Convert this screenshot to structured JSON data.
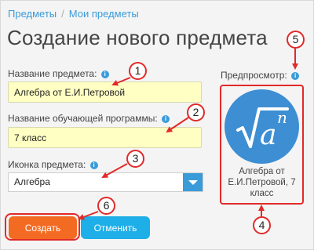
{
  "breadcrumb": {
    "items": [
      "Предметы",
      "Мои предметы"
    ],
    "separator": "/"
  },
  "page_title": "Создание нового предмета",
  "form": {
    "name_label": "Название предмета:",
    "name_value": "Алгебра от Е.И.Петровой",
    "program_label": "Название обучающей программы:",
    "program_value": "7 класс",
    "icon_label": "Иконка предмета:",
    "icon_value": "Алгебра"
  },
  "preview": {
    "label": "Предпросмотр:",
    "caption": "Алгебра от Е.И.Петровой, 7 класс",
    "icon": "square-root-a-n-icon"
  },
  "buttons": {
    "create": "Создать",
    "cancel": "Отменить"
  },
  "info_glyph": "i",
  "callouts": [
    "1",
    "2",
    "3",
    "4",
    "5",
    "6"
  ],
  "colors": {
    "accent": "#3a9bd9",
    "field_bg": "#ffffc4",
    "create": "#f36b22",
    "cancel": "#1eaee8",
    "annotation": "#e12a2a",
    "preview_icon_bg": "#3d8ed2"
  }
}
